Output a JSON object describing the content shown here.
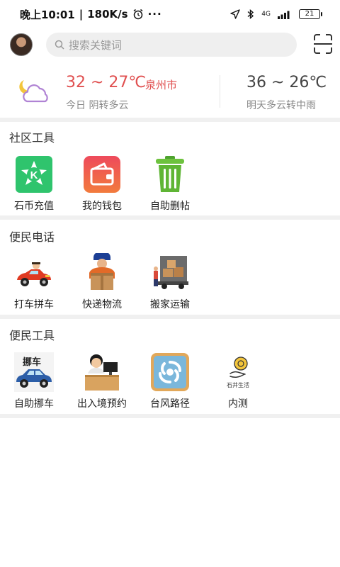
{
  "status_bar": {
    "time": "晚上10:01",
    "speed": "180K/s",
    "dots": "···",
    "network": "4G",
    "battery": "21"
  },
  "header": {
    "search_placeholder": "搜索关键词"
  },
  "weather": {
    "today_temp": "32 ~ 27℃",
    "city": "泉州市",
    "today_desc": "今日 阴转多云",
    "tomorrow_temp": "36 ~ 26℃",
    "tomorrow_desc": "明天多云转中雨"
  },
  "sections": [
    {
      "title": "社区工具",
      "items": [
        {
          "label": "石币充值",
          "icon": "stone-coin-icon"
        },
        {
          "label": "我的钱包",
          "icon": "wallet-icon"
        },
        {
          "label": "自助删帖",
          "icon": "trash-icon"
        }
      ]
    },
    {
      "title": "便民电话",
      "items": [
        {
          "label": "打车拼车",
          "icon": "taxi-icon"
        },
        {
          "label": "快递物流",
          "icon": "courier-icon"
        },
        {
          "label": "搬家运输",
          "icon": "moving-truck-icon"
        }
      ]
    },
    {
      "title": "便民工具",
      "items": [
        {
          "label": "自助挪车",
          "icon": "move-car-icon",
          "badge": "挪车"
        },
        {
          "label": "出入境预约",
          "icon": "immigration-icon"
        },
        {
          "label": "台风路径",
          "icon": "typhoon-icon"
        },
        {
          "label": "内测",
          "icon": "beta-icon",
          "caption": "石井生活"
        }
      ]
    }
  ]
}
